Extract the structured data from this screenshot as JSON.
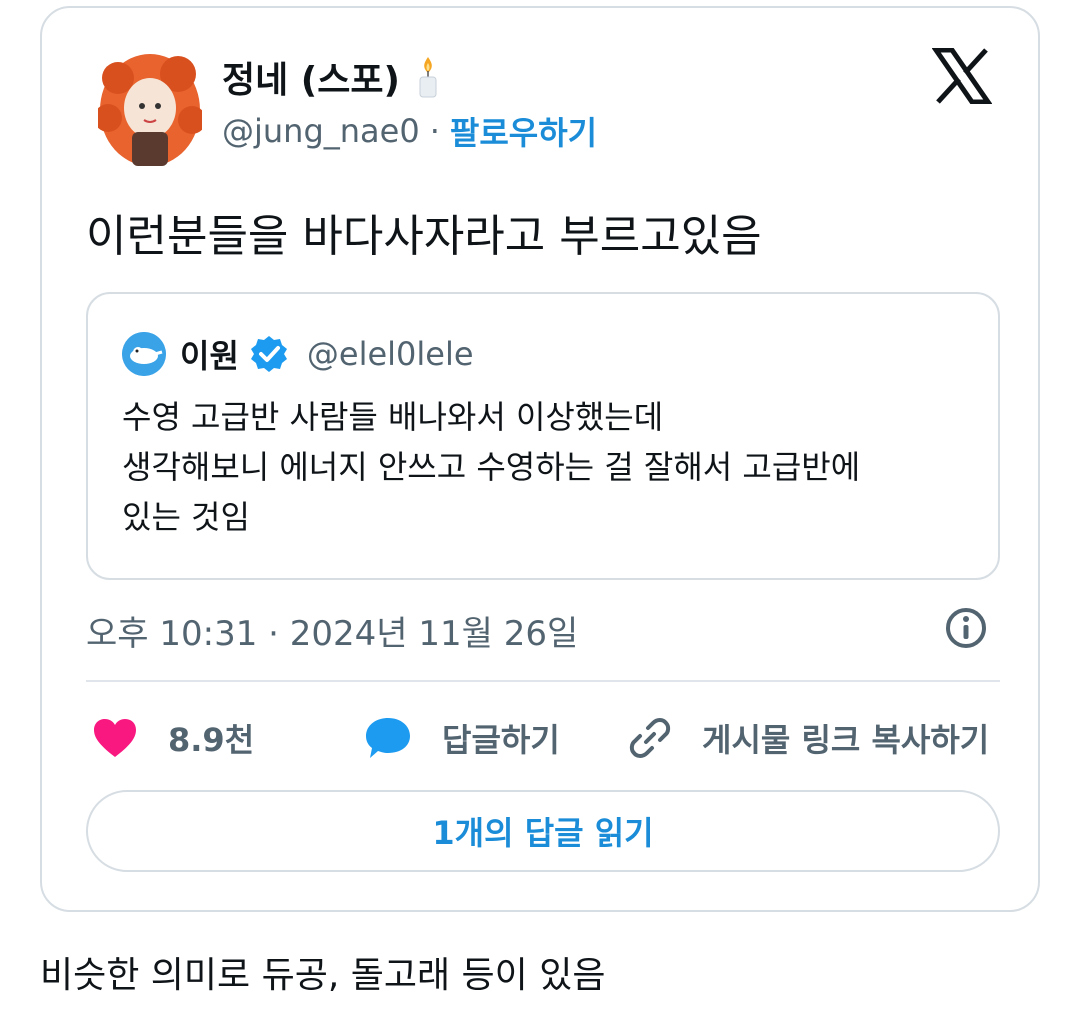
{
  "tweet": {
    "author_name": "정네 (스포)",
    "author_emoji_icon": "candle-icon",
    "author_handle": "@jung_nae0",
    "separator": "·",
    "follow_label": "팔로우하기",
    "platform_icon": "x-logo-icon",
    "text": "이런분들을 바다사자라고 부르고있음",
    "timestamp": "오후 10:31 · 2024년 11월 26일"
  },
  "quoted": {
    "author_name": "이원",
    "author_handle": "@elel0lele",
    "lines": [
      "수영 고급반 사람들 배나와서 이상했는데",
      "생각해보니 에너지 안쓰고 수영하는 걸 잘해서 고급반에",
      "있는 것임"
    ]
  },
  "actions": {
    "like_count": "8.9천",
    "reply_label": "답글하기",
    "copy_link_label": "게시물 링크 복사하기"
  },
  "read_replies_label": "1개의 답글 읽기",
  "caption": "비슷한 의미로 듀공, 돌고래 등이 있음",
  "colors": {
    "like": "#f91880",
    "reply": "#1d9bf0",
    "link": "#1a8cd8",
    "muted": "#536471",
    "border": "#d6dde3"
  }
}
